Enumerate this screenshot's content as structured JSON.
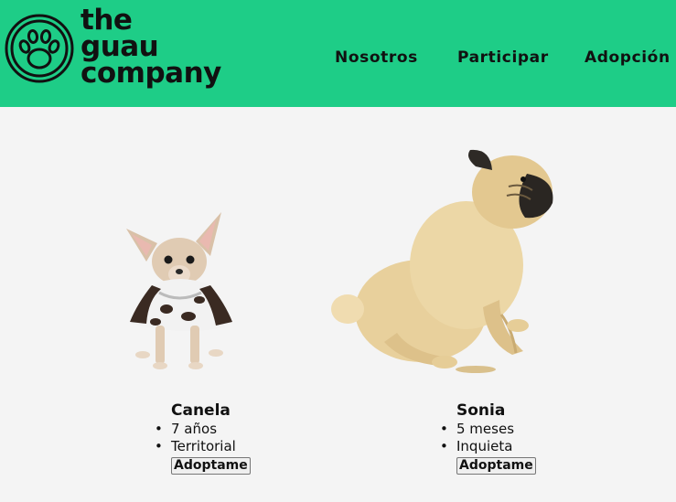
{
  "brand": {
    "line1": "the",
    "line2": "guau",
    "line3": "company",
    "icon": "paw-icon",
    "accent": "#1ecd87"
  },
  "nav": [
    {
      "label": "Nosotros"
    },
    {
      "label": "Participar"
    },
    {
      "label": "Adopción"
    }
  ],
  "pets": [
    {
      "name": "Canela",
      "traits": [
        "7 años",
        "Territorial"
      ],
      "button": "Adoptame",
      "image": "chihuahua-photo"
    },
    {
      "name": "Sonia",
      "traits": [
        "5 meses",
        "Inquieta"
      ],
      "button": "Adoptame",
      "image": "pug-photo"
    }
  ]
}
